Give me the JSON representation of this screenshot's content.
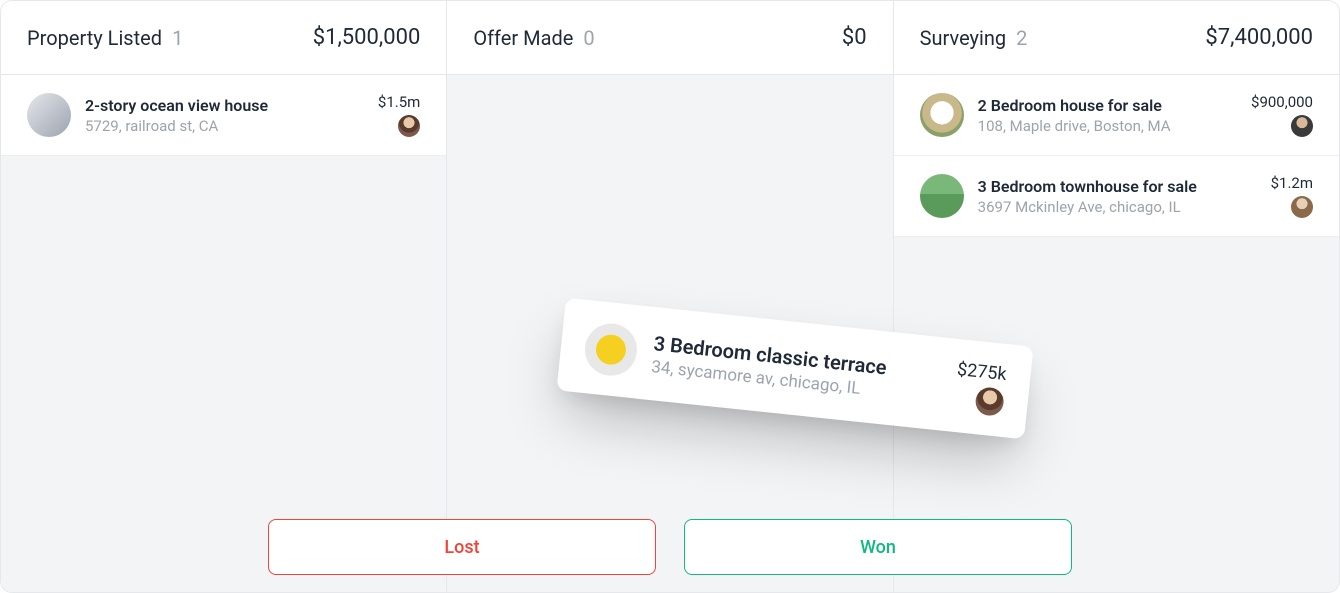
{
  "columns": [
    {
      "title": "Property Listed",
      "count": "1",
      "total": "$1,500,000",
      "cards": [
        {
          "title": "2-story ocean view house",
          "subtitle": "5729, railroad st, CA",
          "price": "$1.5m",
          "thumb_class": "thumb-house-gray",
          "avatar_class": "avatar-1"
        }
      ]
    },
    {
      "title": "Offer Made",
      "count": "0",
      "total": "$0",
      "cards": []
    },
    {
      "title": "Surveying",
      "count": "2",
      "total": "$7,400,000",
      "cards": [
        {
          "title": "2 Bedroom house for sale",
          "subtitle": "108, Maple drive, Boston, MA",
          "price": "$900,000",
          "thumb_class": "thumb-house-white",
          "avatar_class": "avatar-2"
        },
        {
          "title": "3 Bedroom townhouse for sale",
          "subtitle": "3697 Mckinley Ave, chicago, IL",
          "price": "$1.2m",
          "thumb_class": "thumb-house-green",
          "avatar_class": "avatar-3"
        }
      ]
    }
  ],
  "dragging": {
    "title": "3 Bedroom classic terrace",
    "subtitle": "34, sycamore av, chicago, IL",
    "price": "$275k",
    "thumb_class": "thumb-door-yellow",
    "avatar_class": "avatar-1"
  },
  "actions": {
    "lost": "Lost",
    "won": "Won"
  }
}
